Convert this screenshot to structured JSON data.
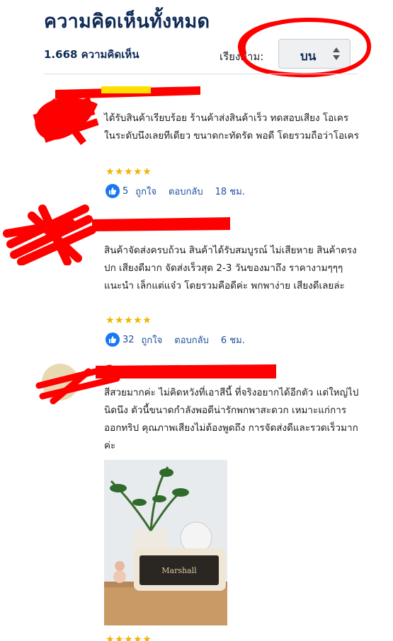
{
  "header": {
    "title": "ความคิดเห็นทั้งหมด",
    "count": "1.668 ความคิดเห็น",
    "sort_label": "เรียงตาม:",
    "sort_value": "บน"
  },
  "reviews": [
    {
      "text": "ได้รับสินค้าเรียบร้อย ร้านค้าส่งสินค้าเร็ว ทดสอบเสียง โอเครในระดับนึงเลยทีเดียว ขนาดกะทัดรัด พอดี โดยรวมถือว่าโอเคร",
      "stars": "★★★★★",
      "likes": "5",
      "like_label": "ถูกใจ",
      "reply_label": "ตอบกลับ",
      "time": "18 ชม."
    },
    {
      "text": "สินค้าจัดส่งครบถ้วน สินค้าได้รับสมบูรณ์ ไม่เสียหาย สินค้าตรงปก เสียงดีมาก จัดส่งเร็วสุด 2-3 วันของมาถึง ราคางามๆๆๆ แนะนำ เล็กแต่แจ๋ว โดยรวมคือดีค่ะ พกพาง่าย เสียงดีเลยล่ะ",
      "stars": "★★★★★",
      "likes": "32",
      "like_label": "ถูกใจ",
      "reply_label": "ตอบกลับ",
      "time": "6 ชม."
    },
    {
      "text": "สีสวยมากค่ะ ไม่คิดหวังที่เอาสีนี้ ที่จริงอยากได้อีกตัว แต่ใหญ่ไปนิดนึง ตัวนี้ขนาดกำลังพอดีน่ารักพกพาสะดวก เหมาะแก่การออกทริป คุณภาพเสียงไม่ต้องพูดถึง การจัดส่งดีและรวดเร็วมากค่ะ",
      "stars": "★★★★★",
      "photo_brand": "Marshall"
    }
  ],
  "colors": {
    "title": "#0f2a56",
    "link": "#1e4fa0",
    "star": "#f0b400",
    "like_icon": "#1877f2",
    "redaction": "#ff0000"
  }
}
